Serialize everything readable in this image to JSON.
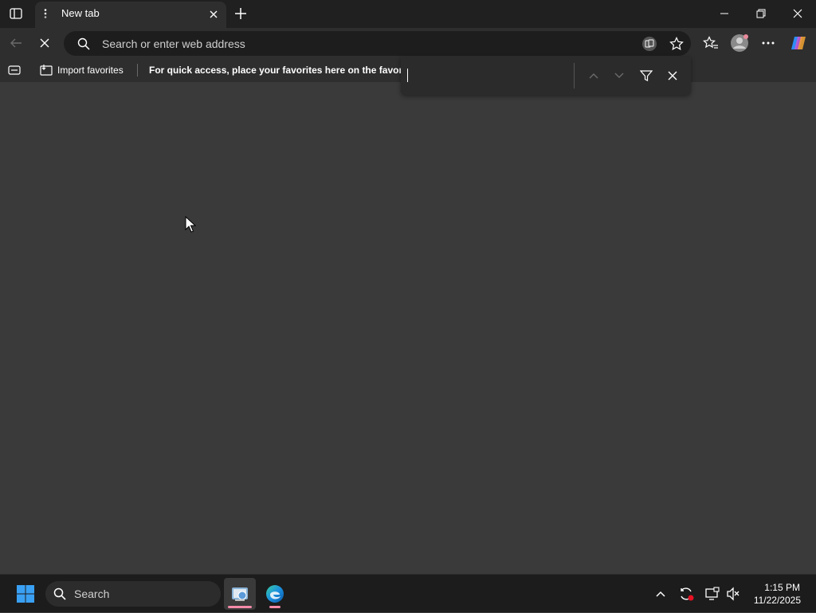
{
  "tabs": [
    {
      "title": "New tab",
      "active": true
    }
  ],
  "address_bar": {
    "placeholder": "Search or enter web address"
  },
  "favorites_bar": {
    "import_label": "Import favorites",
    "hint": "For quick access, place your favorites here on the favorites"
  },
  "find_bar": {
    "query": ""
  },
  "taskbar": {
    "search_label": "Search",
    "time": "1:15 PM",
    "date": "11/22/2025"
  },
  "colors": {
    "titlebar": "#202020",
    "toolbar": "#2e2e2e",
    "content": "#3a3a3a",
    "taskbar": "#1c1c1c",
    "accent_windows": "#3aa0f3",
    "indicator": "#f38ba8"
  }
}
